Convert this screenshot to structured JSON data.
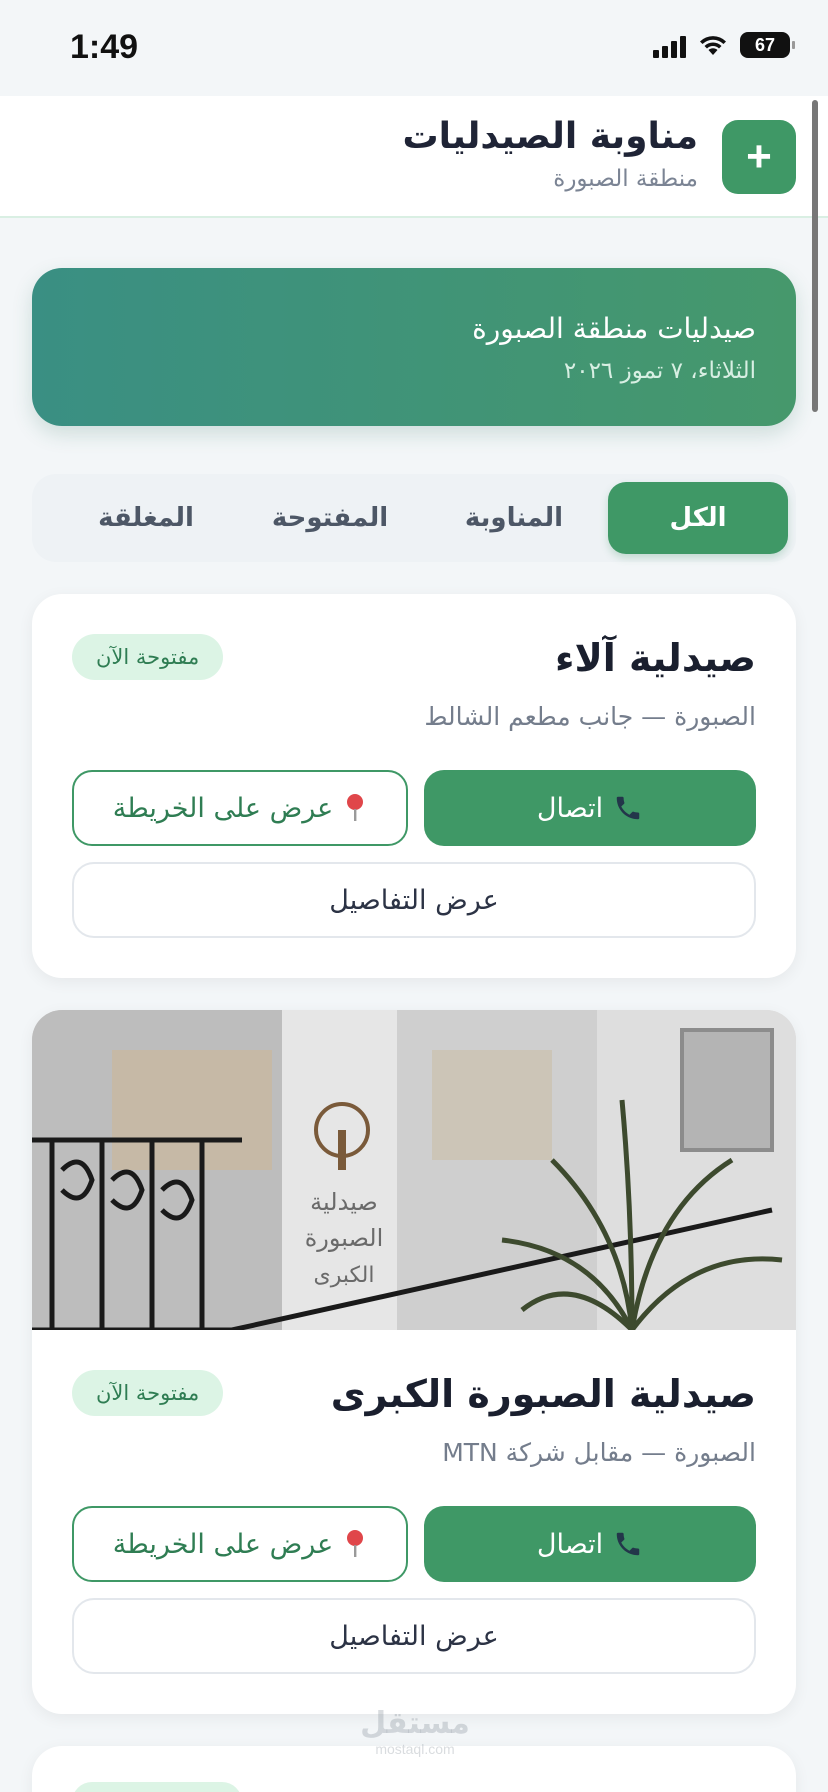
{
  "status_bar": {
    "time": "1:49",
    "battery": "67"
  },
  "header": {
    "title": "مناوبة الصيدليات",
    "subtitle": "منطقة الصبورة",
    "add_button_label": "+"
  },
  "banner": {
    "title": "صيدليات منطقة الصبورة",
    "date": "الثلاثاء، ٧ تموز ٢٠٢٦"
  },
  "tabs": [
    {
      "label": "الكل",
      "active": true
    },
    {
      "label": "المناوبة",
      "active": false
    },
    {
      "label": "المفتوحة",
      "active": false
    },
    {
      "label": "المغلقة",
      "active": false
    }
  ],
  "pharmacies": [
    {
      "name": "صيدلية آلاء",
      "status": "مفتوحة الآن",
      "address": "الصبورة — جانب مطعم الشالط",
      "call_label": "اتصال",
      "map_label": "عرض على الخريطة",
      "details_label": "عرض التفاصيل",
      "has_photo": false
    },
    {
      "name": "صيدلية الصبورة الكبرى",
      "status": "مفتوحة الآن",
      "address": "الصبورة — مقابل شركة MTN",
      "call_label": "اتصال",
      "map_label": "عرض على الخريطة",
      "details_label": "عرض التفاصيل",
      "has_photo": true,
      "photo_sign": [
        "صيدلية",
        "الصبورة",
        "الكبرى"
      ]
    }
  ],
  "icons": {
    "phone": "phone-icon",
    "map_pin": "map-pin-icon",
    "plus": "plus-icon"
  },
  "colors": {
    "primary": "#3f9866",
    "badge_bg": "#dcf4e5",
    "badge_text": "#2f7d53",
    "background": "#f3f6f8"
  },
  "watermark": {
    "ar": "مستقل",
    "en": "mostaql.com"
  }
}
